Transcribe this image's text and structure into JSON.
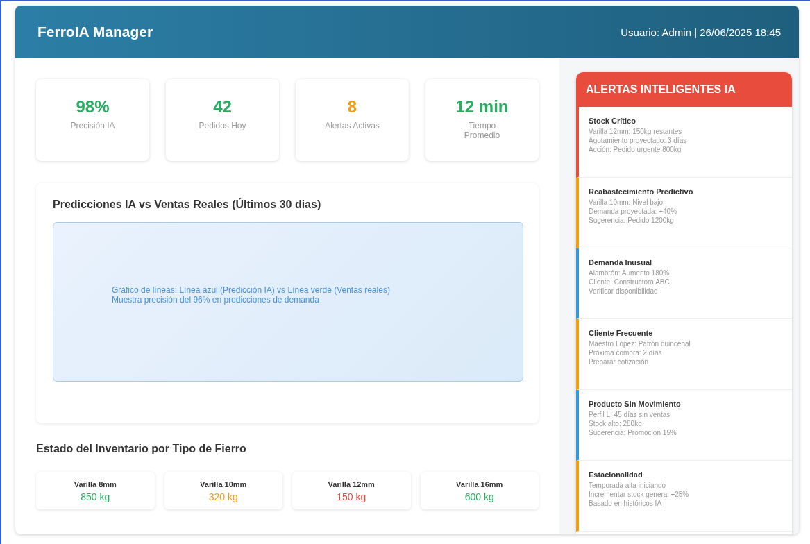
{
  "header": {
    "title": "FerroIA Manager",
    "user_info": "Usuario: Admin | 26/06/2025 18:45"
  },
  "stats": [
    {
      "value": "98%",
      "label": "Precisión IA",
      "color": "#27ae60"
    },
    {
      "value": "42",
      "label": "Pedidos Hoy",
      "color": "#27ae60"
    },
    {
      "value": "8",
      "label": "Alertas Activas",
      "color": "#f39c12"
    },
    {
      "value": "12 min",
      "label": "Tiempo Promedio",
      "color": "#27ae60"
    }
  ],
  "prediction": {
    "title": "Predicciones IA vs Ventas Reales (Últimos 30 dias)",
    "placeholder_lines": [
      "Gráfico de líneas: Línea azul (Predicción IA) vs Línea verde (Ventas reales)",
      "Muestra precisión del 96% en predicciones de demanda"
    ]
  },
  "inventory": {
    "title": "Estado del Inventario por Tipo de Fierro",
    "items": [
      {
        "name": "Varilla 8mm",
        "amount": "850 kg",
        "color": "#27ae60"
      },
      {
        "name": "Varilla 10mm",
        "amount": "320 kg",
        "color": "#f39c12"
      },
      {
        "name": "Varilla 12mm",
        "amount": "150 kg",
        "color": "#e74c3c"
      },
      {
        "name": "Varilla 16mm",
        "amount": "600 kg",
        "color": "#27ae60"
      }
    ]
  },
  "alerts": {
    "title": "ALERTAS INTELIGENTES IA",
    "items": [
      {
        "title": "Stock Crítico",
        "lines": [
          "Varilla 12mm: 150kg restantes",
          "Agotamiento proyectado: 3 días",
          "Acción: Pedido urgente 800kg"
        ],
        "color": "#e74c3c"
      },
      {
        "title": "Reabastecimiento Predictivo",
        "lines": [
          "Varilla 10mm: Nivel bajo",
          "Demanda proyectada: +40%",
          "Sugerencia: Pedido 1200kg"
        ],
        "color": "#f39c12"
      },
      {
        "title": "Demanda Inusual",
        "lines": [
          "Alambrón: Aumento 180%",
          "Cliente: Constructora ABC",
          "Verificar disponibilidad"
        ],
        "color": "#3498db"
      },
      {
        "title": "Cliente Frecuente",
        "lines": [
          "Maestro López: Patrón quincenal",
          "Próxima compra: 2 días",
          "Preparar cotización"
        ],
        "color": "#f39c12"
      },
      {
        "title": "Producto Sin Movimiento",
        "lines": [
          "Perfil L: 45 días sin ventas",
          "Stock alto: 280kg",
          "Sugerencia: Promoción 15%"
        ],
        "color": "#3498db"
      },
      {
        "title": "Estacionalidad",
        "lines": [
          "Temporada alta iniciando",
          "Incrementar stock general +25%",
          "Basado en históricos IA"
        ],
        "color": "#f39c12"
      }
    ]
  }
}
